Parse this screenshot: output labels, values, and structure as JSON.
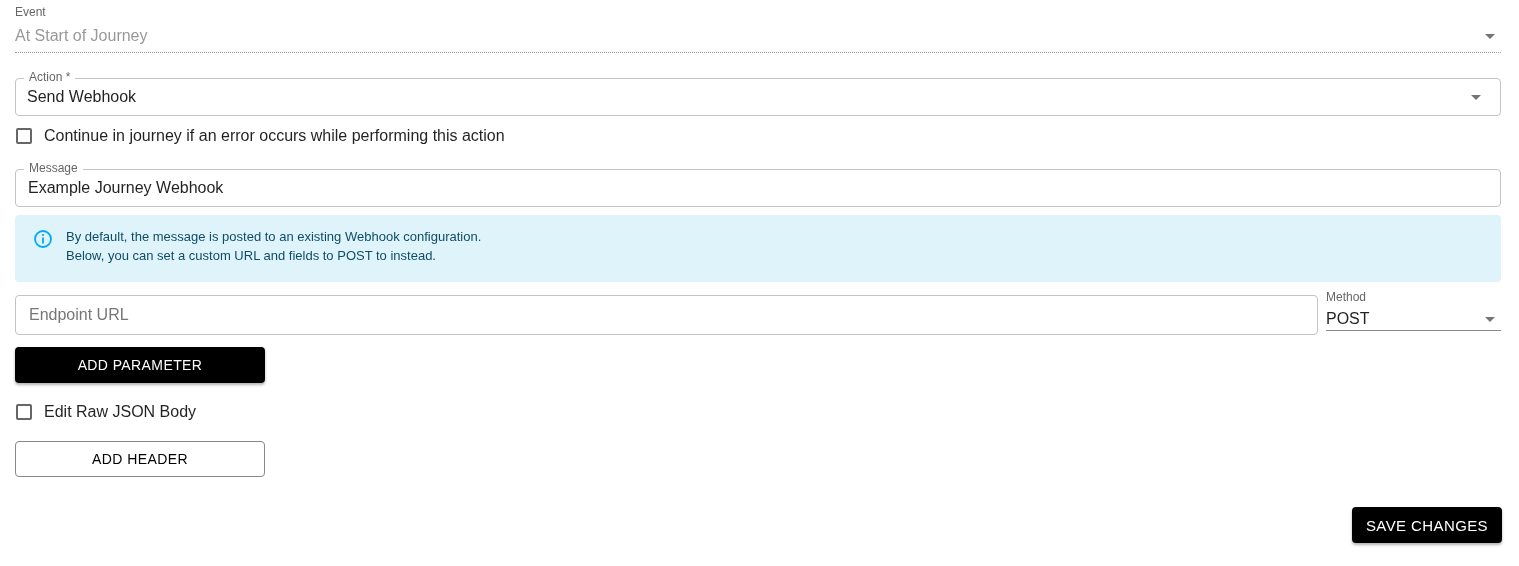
{
  "event": {
    "label": "Event",
    "value": "At Start of Journey",
    "disabled": true
  },
  "action": {
    "label": "Action *",
    "value": "Send Webhook"
  },
  "continue_on_error": {
    "label": "Continue in journey if an error occurs while performing this action",
    "checked": false
  },
  "message": {
    "label": "Message",
    "value": "Example Journey Webhook"
  },
  "info": {
    "lines": [
      "By default, the message is posted to an existing Webhook configuration.",
      "Below, you can set a custom URL and fields to POST to instead."
    ]
  },
  "endpoint": {
    "placeholder": "Endpoint URL"
  },
  "method": {
    "label": "Method",
    "value": "POST"
  },
  "add_parameter": "ADD PARAMETER",
  "edit_raw_json": {
    "label": "Edit Raw JSON Body",
    "checked": false
  },
  "add_header": "ADD HEADER",
  "save": "SAVE CHANGES"
}
